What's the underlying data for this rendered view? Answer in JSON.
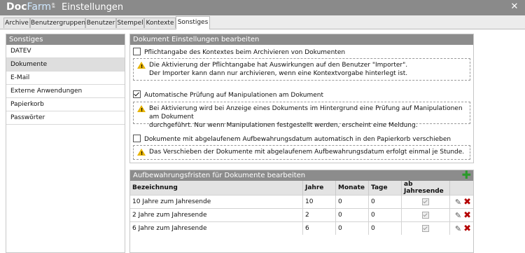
{
  "app": {
    "logo_doc": "Doc",
    "logo_farm": "Farm",
    "logo_reg": "®",
    "separator": "-",
    "title": "Einstellungen"
  },
  "tabs": [
    {
      "label": "Archive"
    },
    {
      "label": "Benutzergruppen"
    },
    {
      "label": "Benutzer"
    },
    {
      "label": "Stempel"
    },
    {
      "label": "Kontexte"
    },
    {
      "label": "Sonstiges",
      "active": true
    }
  ],
  "sidebar": {
    "title": "Sonstiges",
    "items": [
      {
        "label": "DATEV"
      },
      {
        "label": "Dokumente",
        "active": true
      },
      {
        "label": "E-Mail"
      },
      {
        "label": "Externe Anwendungen"
      },
      {
        "label": "Papierkorb"
      },
      {
        "label": "Passwörter"
      }
    ]
  },
  "doc_settings": {
    "title": "Dokument Einstellungen bearbeiten",
    "option1": {
      "label": "Pflichtangabe des Kontextes beim Archivieren von Dokumenten",
      "checked": false,
      "note_line1": "Die Aktivierung der Pflichtangabe hat Auswirkungen auf den Benutzer \"Importer\".",
      "note_line2": "Der Importer kann dann nur archivieren, wenn eine Kontextvorgabe hinterlegt ist."
    },
    "option2": {
      "label": "Automatische Prüfung auf Manipulationen am Dokument",
      "checked": true,
      "note_line1": "Bei Aktivierung wird bei Anzeige eines Dokuments im Hintergrund eine Prüfung auf Manipulationen am Dokument",
      "note_line2": "durchgeführt. Nur wenn Manipulationen festgestellt werden, erscheint eine Meldung."
    },
    "option3": {
      "label": "Dokumente mit abgelaufenem Aufbewahrungsdatum automatisch in den Papierkorb verschieben",
      "checked": false,
      "note_line1": "Das Verschieben der Dokumente mit abgelaufenem Aufbewahrungsdatum erfolgt einmal je Stunde."
    }
  },
  "retention": {
    "title": "Aufbewahrungsfristen für Dokumente bearbeiten",
    "columns": {
      "name": "Bezeichnung",
      "years": "Jahre",
      "months": "Monate",
      "days": "Tage",
      "year_end": "ab Jahresende"
    },
    "rows": [
      {
        "name": "10 Jahre zum Jahresende",
        "years": "10",
        "months": "0",
        "days": "0",
        "year_end": true
      },
      {
        "name": "2 Jahre zum Jahresende",
        "years": "2",
        "months": "0",
        "days": "0",
        "year_end": true
      },
      {
        "name": "6 Jahre zum Jahresende",
        "years": "6",
        "months": "0",
        "days": "0",
        "year_end": true
      }
    ]
  },
  "colors": {
    "titlebar": "#8a8a8a",
    "panel_header": "#8c8c8c",
    "warning": "#e8b400",
    "delete": "#b40000",
    "add": "#2a9a2a"
  }
}
